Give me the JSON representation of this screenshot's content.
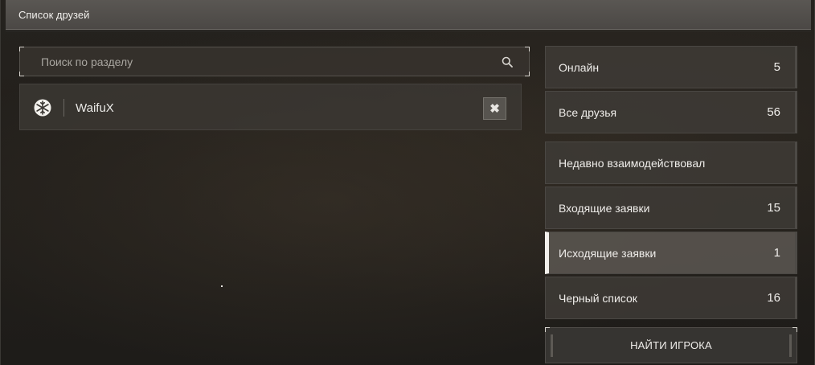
{
  "window": {
    "title": "Список друзей"
  },
  "search": {
    "placeholder": "Поиск по разделу",
    "value": "",
    "icon": "search-icon"
  },
  "friends": [
    {
      "name": "WaifuX",
      "avatar_icon": "snowflake-icon",
      "remove_label": "✖"
    }
  ],
  "categories": [
    {
      "label": "Онлайн",
      "count": "5",
      "active": false
    },
    {
      "label": "Все друзья",
      "count": "56",
      "active": false
    },
    {
      "label": "Недавно взаимодействовал",
      "count": "",
      "active": false
    },
    {
      "label": "Входящие заявки",
      "count": "15",
      "active": false
    },
    {
      "label": "Исходящие заявки",
      "count": "1",
      "active": true
    },
    {
      "label": "Черный список",
      "count": "16",
      "active": false
    }
  ],
  "actions": {
    "find_player_label": "НАЙТИ ИГРОКА"
  },
  "colors": {
    "accent": "#f2f0ec",
    "panel": "#3e3a35",
    "titlebar": "#55524e"
  }
}
